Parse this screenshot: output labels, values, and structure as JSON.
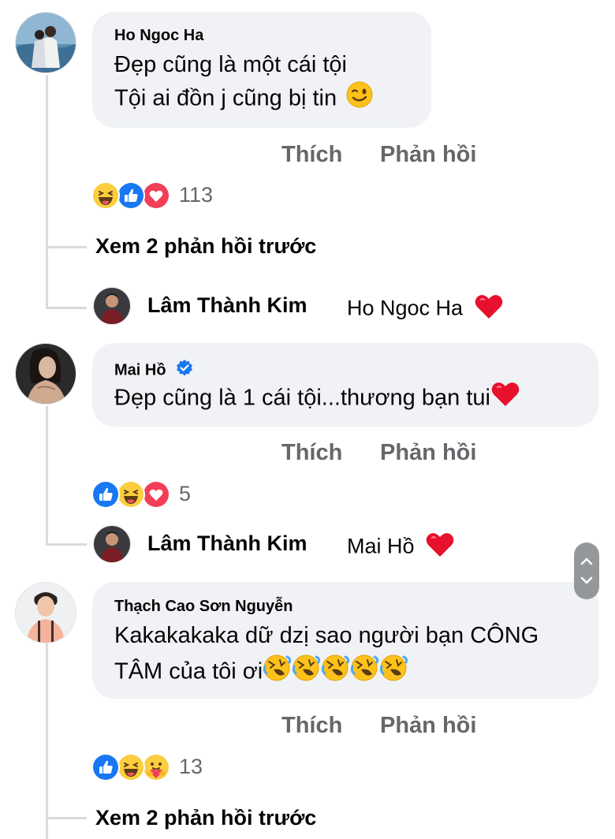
{
  "comments": [
    {
      "author": "Ho Ngoc Ha",
      "verified": false,
      "lines": [
        "Đẹp cũng là một cái tội",
        "Tội ai đồn j cũng bị tin"
      ],
      "line2_emoji": "wink-emoji",
      "like_label": "Thích",
      "reply_label": "Phản hồi",
      "reactions": [
        "haha",
        "like",
        "love"
      ],
      "reaction_count": "113",
      "view_more": "Xem 2 phản hồi trước",
      "reply": {
        "author": "Lâm Thành Kim",
        "text": "Ho Ngoc Ha",
        "emoji": "red-heart-emoji"
      }
    },
    {
      "author": "Mai Hồ",
      "verified": true,
      "lines": [
        "Đẹp cũng là 1 cái tội...thương bạn tui"
      ],
      "line_emoji": "red-heart-emoji",
      "like_label": "Thích",
      "reply_label": "Phản hồi",
      "reactions": [
        "like",
        "haha",
        "love"
      ],
      "reaction_count": "5",
      "reply": {
        "author": "Lâm Thành Kim",
        "text": "Mai Hồ",
        "emoji": "red-heart-emoji"
      }
    },
    {
      "author": "Thạch Cao Sơn Nguyễn",
      "verified": false,
      "lines": [
        "Kakakakaka dữ dzị sao người bạn CÔNG",
        "TÂM của tôi ơi"
      ],
      "line2_emoji": "rolling-laughing-emoji",
      "line2_emoji_count": 5,
      "like_label": "Thích",
      "reply_label": "Phản hồi",
      "reactions": [
        "like",
        "haha",
        "care"
      ],
      "reaction_count": "13",
      "view_more": "Xem 2 phản hồi trước"
    }
  ],
  "scroll_control": {
    "up_icon": "chevron-up-icon",
    "down_icon": "chevron-down-icon"
  },
  "colors": {
    "bubble": "#f0f2f5",
    "action_text": "#65676b",
    "like_blue": "#1877f2",
    "love_red": "#f33e58",
    "haha_yellow": "#fbcd3f",
    "thread_line": "#d8dadf"
  }
}
